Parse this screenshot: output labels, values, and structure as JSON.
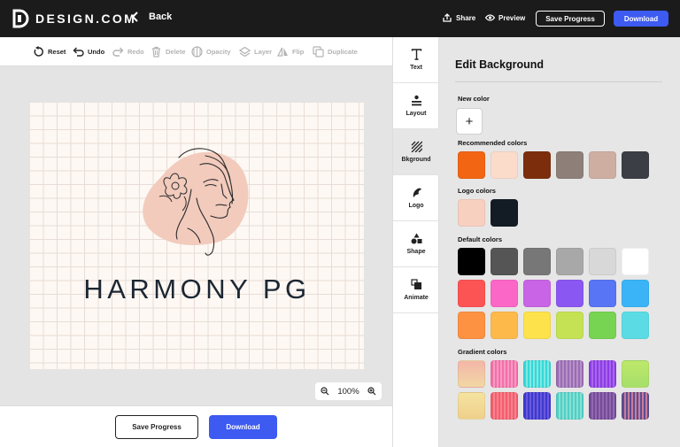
{
  "brand": {
    "name": "DESIGN.COM"
  },
  "nav": {
    "back_label": "Back"
  },
  "header": {
    "share_label": "Share",
    "preview_label": "Preview",
    "save_label": "Save Progress",
    "download_label": "Download"
  },
  "toolbar": {
    "reset": "Reset",
    "undo": "Undo",
    "redo": "Redo",
    "delete": "Delete",
    "opacity": "Opacity",
    "layer": "Layer",
    "flip": "Flip",
    "duplicate": "Duplicate"
  },
  "canvas": {
    "logo_text": "HARMONY PG",
    "zoom": "100%",
    "accent_blob": "#f2cbbd"
  },
  "footer": {
    "save_label": "Save Progress",
    "download_label": "Download"
  },
  "sidetabs": [
    {
      "label": "Text",
      "icon": "text-icon"
    },
    {
      "label": "Layout",
      "icon": "layout-icon"
    },
    {
      "label": "Bkground",
      "icon": "background-icon"
    },
    {
      "label": "Logo",
      "icon": "logo-icon"
    },
    {
      "label": "Shape",
      "icon": "shape-icon"
    },
    {
      "label": "Animate",
      "icon": "animate-icon"
    }
  ],
  "panel": {
    "title": "Edit Background",
    "new_color_label": "New color",
    "new_color_symbol": "+",
    "recommended_label": "Recommended colors",
    "recommended": [
      "#f26513",
      "#fbdccb",
      "#7c2e0c",
      "#8e7f79",
      "#cfaea2",
      "#3b3f45"
    ],
    "logo_label": "Logo colors",
    "logo": [
      "#f7d0c0",
      "#131c24"
    ],
    "default_label": "Default colors",
    "default": [
      [
        "#000000",
        "#555555",
        "#777777",
        "#a8a8a8",
        "#d8d8d8",
        "#ffffff"
      ],
      [
        "#fc5454",
        "#fb67c7",
        "#c964e6",
        "#8b57f2",
        "#5875f5",
        "#3ab4f7"
      ],
      [
        "#fd9243",
        "#fdba4b",
        "#fde24b",
        "#c5e254",
        "#77d452",
        "#5bdce4"
      ]
    ],
    "gradient_label": "Gradient colors",
    "gradient": [
      [
        "linear-gradient(180deg,#f4b6a9,#f1d7a4)",
        "repeating-linear-gradient(90deg,#f36fa9 0 2px,#f79ac2 2px 4px)",
        "repeating-linear-gradient(90deg,#35d7d7 0 2px,#7fe8e3 2px 4px)",
        "repeating-linear-gradient(90deg,#9a6cb3 0 2px,#b591c8 2px 4px)",
        "repeating-linear-gradient(90deg,#8c3de3 0 2px,#a866ee 2px 4px)",
        "linear-gradient(180deg,#bde86a,#a6df6a)"
      ],
      [
        "linear-gradient(180deg,#f5e3a0,#efd08c)",
        "repeating-linear-gradient(90deg,#f45d6d 0 2px,#f7838f 2px 4px)",
        "repeating-linear-gradient(90deg,#3d3acb 0 2px,#6a58e0 2px 4px)",
        "repeating-linear-gradient(90deg,#4fd0c4 0 2px,#89dfd6 2px 4px)",
        "repeating-linear-gradient(90deg,#744b96 0 2px,#9268b2 2px 4px)",
        "repeating-linear-gradient(90deg,#5d4e8f 0 2px,#c97d9e 2px 4px)"
      ]
    ]
  }
}
